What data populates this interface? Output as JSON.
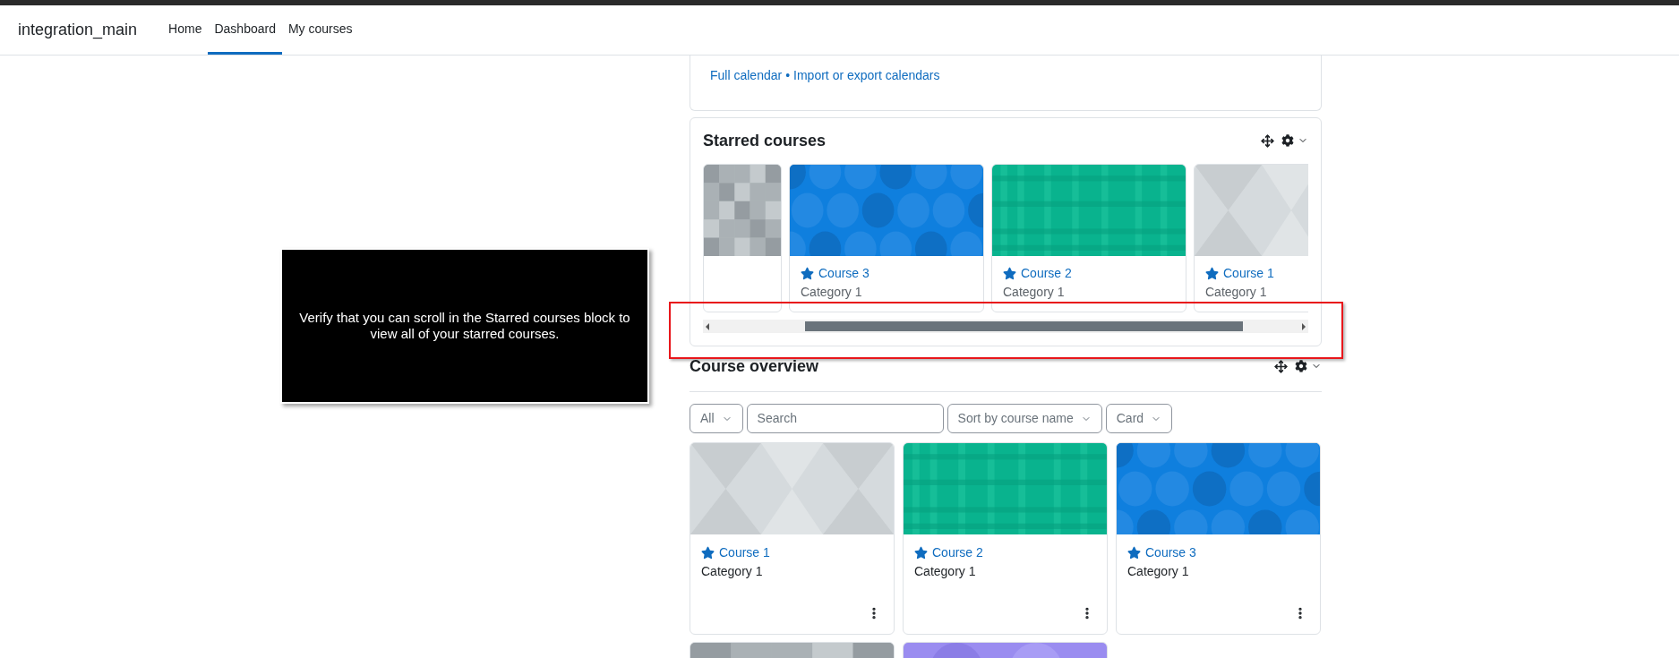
{
  "navbar": {
    "site_name": "integration_main",
    "links": [
      {
        "label": "Home",
        "selected": false
      },
      {
        "label": "Dashboard",
        "selected": true
      },
      {
        "label": "My courses",
        "selected": false
      }
    ]
  },
  "calendar_block": {
    "links": [
      "Full calendar",
      "Import or export calendars"
    ],
    "separator": "•"
  },
  "starred_courses": {
    "title": "Starred courses",
    "courses": [
      {
        "kind": "squares"
      },
      {
        "name": "Course 3",
        "category": "Category 1",
        "kind": "octagons",
        "starred": true
      },
      {
        "name": "Course 2",
        "category": "Category 1",
        "kind": "plaid",
        "starred": true
      },
      {
        "name": "Course 1",
        "category": "Category 1",
        "kind": "triangles",
        "starred": true
      }
    ]
  },
  "callout": {
    "text": "Verify that you can scroll in the Starred courses block to view all of your starred courses."
  },
  "course_overview": {
    "title": "Course overview",
    "filters": [
      {
        "kind": "dropdown",
        "label": "All"
      },
      {
        "kind": "search",
        "placeholder": "Search"
      },
      {
        "kind": "dropdown",
        "label": "Sort by course name"
      },
      {
        "kind": "dropdown",
        "label": "Card"
      }
    ],
    "courses": [
      {
        "name": "Course 1",
        "category": "Category 1",
        "kind": "triangles",
        "starred": true
      },
      {
        "name": "Course 2",
        "category": "Category 1",
        "kind": "plaid",
        "starred": true
      },
      {
        "name": "Course 3",
        "category": "Category 1",
        "kind": "octagons",
        "starred": true
      },
      {
        "kind": "squares"
      },
      {
        "kind": "purple"
      }
    ]
  }
}
